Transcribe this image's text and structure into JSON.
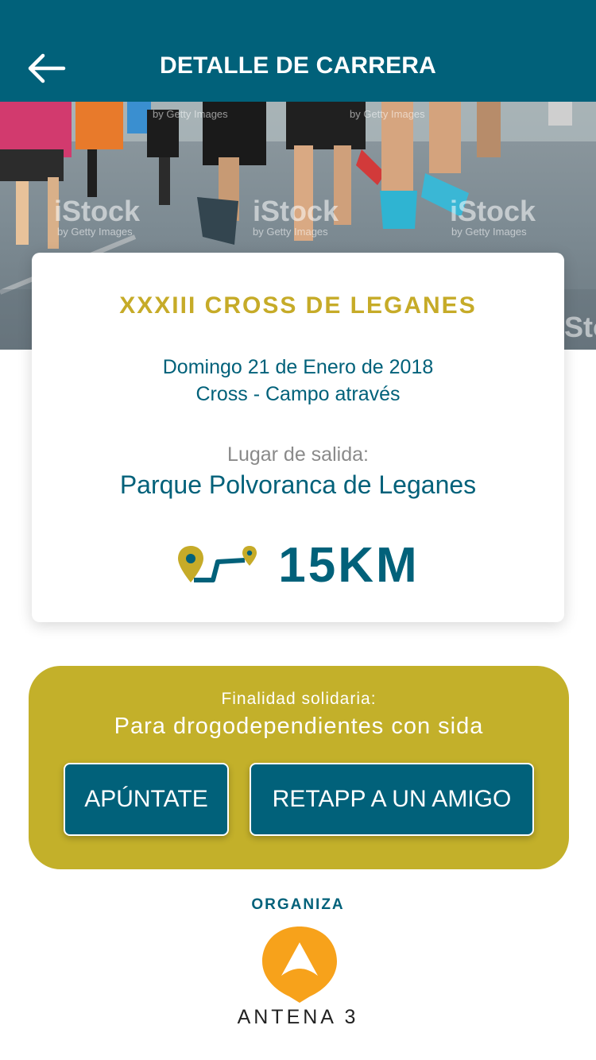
{
  "header": {
    "title": "DETALLE DE CARRERA",
    "back_icon": "arrow-left-icon"
  },
  "hero": {
    "watermark": "iStock",
    "watermark_sub": "by Getty Images"
  },
  "race": {
    "name": "XXXIII CROSS DE LEGANES",
    "date": "Domingo 21 de Enero de 2018",
    "type": "Cross - Campo através",
    "start_label": "Lugar de salida:",
    "start_place": "Parque Polvoranca de Leganes",
    "distance": "15KM",
    "route_icon": "route-pin-icon"
  },
  "solidarity": {
    "label": "Finalidad solidaria:",
    "value": "Para drogodependientes con sida"
  },
  "actions": {
    "join_label": "APÚNTATE",
    "retapp_label": "RETAPP A UN AMIGO"
  },
  "organizer": {
    "label": "ORGANIZA",
    "logo_text": "ANTENA 3"
  },
  "colors": {
    "primary": "#01617a",
    "gold": "#c6ab28",
    "solidarity_bg": "#c3b02a",
    "logo_orange": "#f7a21b"
  }
}
